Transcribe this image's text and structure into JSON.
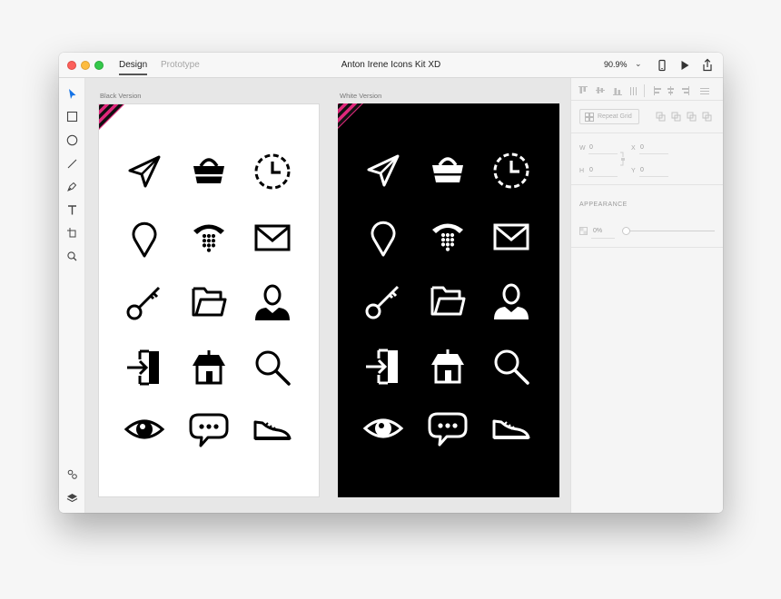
{
  "window": {
    "title": "Anton Irene Icons Kit XD",
    "tabs": {
      "design": "Design",
      "prototype": "Prototype"
    },
    "zoom": "90.9%"
  },
  "toolbar": {
    "tools": [
      "select-tool",
      "rectangle-tool",
      "ellipse-tool",
      "line-tool",
      "pen-tool",
      "text-tool",
      "artboard-tool",
      "zoom-tool"
    ],
    "bottom_tools": [
      "symbols-tool",
      "layers-tool"
    ],
    "accent_color": "#1473e6"
  },
  "artboards": {
    "left_label": "Black Version",
    "right_label": "White Version",
    "icon_names": [
      "paper-plane",
      "shopping-basket",
      "clock",
      "location-pin",
      "telephone",
      "envelope",
      "key",
      "folder",
      "user",
      "sign-in",
      "home",
      "search",
      "eye",
      "chat-bubble",
      "sneaker"
    ]
  },
  "properties": {
    "repeat_grid": "Repeat Grid",
    "w_label": "W",
    "w_value": "0",
    "x_label": "X",
    "x_value": "0",
    "h_label": "H",
    "h_value": "0",
    "y_label": "Y",
    "y_value": "0",
    "appearance_label": "APPEARANCE",
    "opacity_value": "0%",
    "opacity": 0
  }
}
